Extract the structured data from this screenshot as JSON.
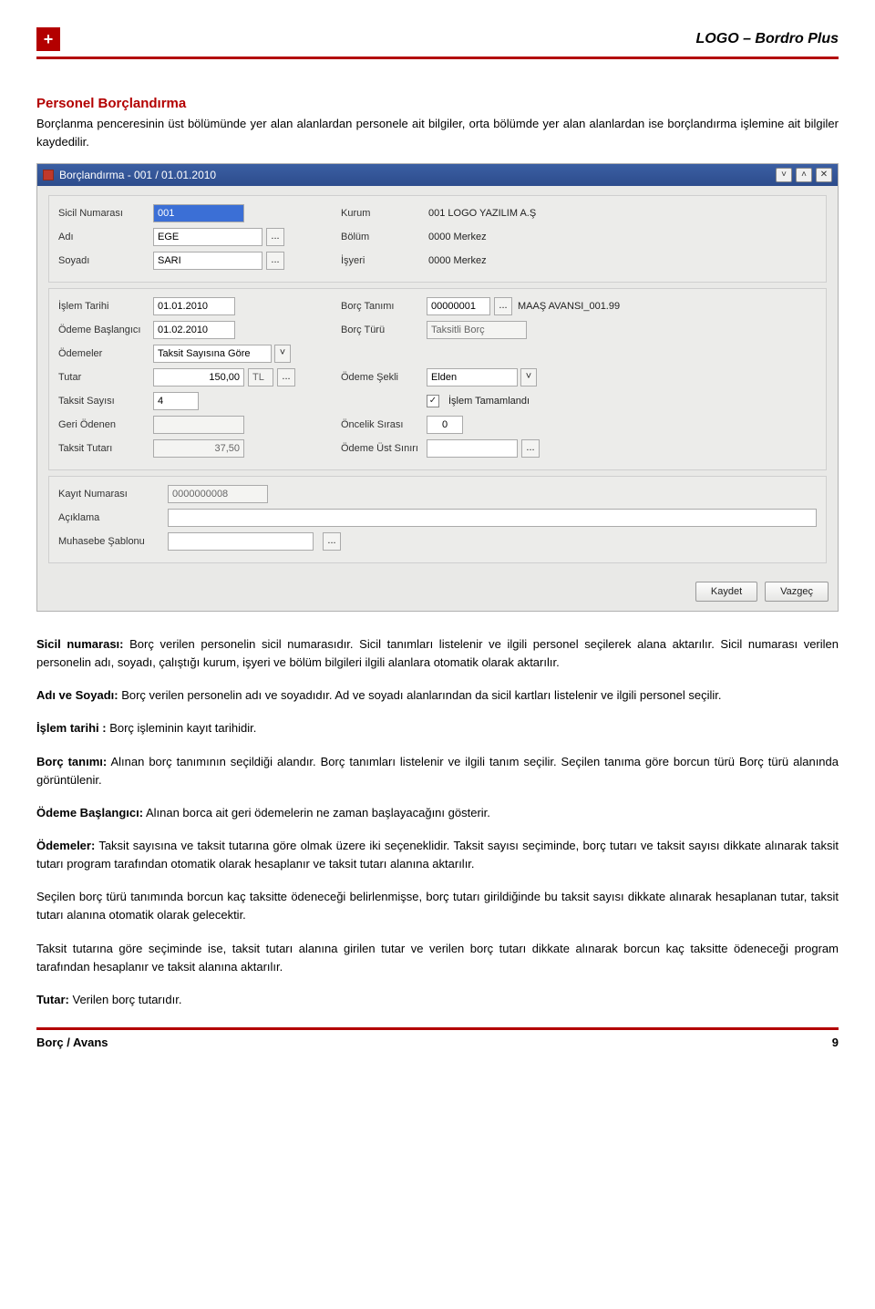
{
  "header": {
    "plus": "+",
    "brand": "LOGO – Bordro Plus"
  },
  "section_title": "Personel Borçlandırma",
  "intro": "Borçlanma penceresinin üst bölümünde yer alan alanlardan personele ait bilgiler, orta bölümde yer alan alanlardan ise borçlandırma işlemine ait bilgiler kaydedilir.",
  "window": {
    "title": "Borçlandırma - 001 / 01.01.2010",
    "tb_down": "˅",
    "tb_up": "˄",
    "tb_close": "✕",
    "top": {
      "sicil_lbl": "Sicil Numarası",
      "sicil_val": "001",
      "adi_lbl": "Adı",
      "adi_val": "EGE",
      "soyadi_lbl": "Soyadı",
      "soyadi_val": "SARI",
      "kurum_lbl": "Kurum",
      "kurum_val": "001 LOGO YAZILIM A.Ş",
      "bolum_lbl": "Bölüm",
      "bolum_val": "0000 Merkez",
      "isyeri_lbl": "İşyeri",
      "isyeri_val": "0000 Merkez"
    },
    "mid": {
      "islem_tarihi_lbl": "İşlem Tarihi",
      "islem_tarihi_val": "01.01.2010",
      "odeme_baslangici_lbl": "Ödeme Başlangıcı",
      "odeme_baslangici_val": "01.02.2010",
      "odemeler_lbl": "Ödemeler",
      "odemeler_val": "Taksit Sayısına Göre",
      "tutar_lbl": "Tutar",
      "tutar_val": "150,00",
      "tutar_cur": "TL",
      "taksit_sayisi_lbl": "Taksit Sayısı",
      "taksit_sayisi_val": "4",
      "geri_odenen_lbl": "Geri Ödenen",
      "geri_odenen_val": "",
      "taksit_tutari_lbl": "Taksit Tutarı",
      "taksit_tutari_val": "37,50",
      "borc_tanimi_lbl": "Borç Tanımı",
      "borc_tanimi_val": "00000001",
      "borc_tanimi_desc": "MAAŞ AVANSI_001.99",
      "borc_turu_lbl": "Borç Türü",
      "borc_turu_val": "Taksitli Borç",
      "odeme_sekli_lbl": "Ödeme Şekli",
      "odeme_sekli_val": "Elden",
      "islem_tamamlandi_lbl": "İşlem Tamamlandı",
      "islem_tamamlandi_check": "✓",
      "oncelik_sirasi_lbl": "Öncelik Sırası",
      "oncelik_sirasi_val": "0",
      "odeme_ust_siniri_lbl": "Ödeme Üst Sınırı",
      "odeme_ust_siniri_val": ""
    },
    "bot": {
      "kayit_no_lbl": "Kayıt Numarası",
      "kayit_no_val": "0000000008",
      "aciklama_lbl": "Açıklama",
      "aciklama_val": "",
      "muhasebe_lbl": "Muhasebe Şablonu",
      "muhasebe_val": ""
    },
    "btn_save": "Kaydet",
    "btn_cancel": "Vazgeç",
    "ellipsis": "..."
  },
  "defs": {
    "sicil_t": "Sicil numarası:",
    "sicil_b": " Borç verilen personelin sicil numarasıdır. Sicil tanımları listelenir ve ilgili personel seçilerek alana aktarılır. Sicil numarası verilen personelin adı, soyadı, çalıştığı kurum, işyeri ve bölüm bilgileri ilgili alanlara otomatik olarak aktarılır.",
    "adi_t": "Adı ve Soyadı:",
    "adi_b": " Borç verilen personelin adı ve soyadıdır. Ad ve soyadı alanlarından da sicil kartları listelenir ve ilgili personel seçilir.",
    "islem_t": "İşlem tarihi :",
    "islem_b": " Borç işleminin kayıt tarihidir.",
    "borc_t": "Borç tanımı:",
    "borc_b": " Alınan borç tanımının seçildiği alandır. Borç tanımları listelenir ve ilgili tanım seçilir. Seçilen tanıma göre borcun türü Borç türü alanında görüntülenir.",
    "odbas_t": "Ödeme Başlangıcı:",
    "odbas_b": " Alınan borca ait geri ödemelerin ne zaman başlayacağını gösterir.",
    "odeme_t": "Ödemeler:",
    "odeme_b": " Taksit sayısına ve taksit tutarına göre olmak üzere iki seçeneklidir. Taksit sayısı seçiminde, borç tutarı ve taksit sayısı dikkate alınarak taksit tutarı program tarafından otomatik olarak hesaplanır ve taksit tutarı alanına aktarılır.",
    "para2": "Seçilen borç türü tanımında borcun kaç taksitte ödeneceği belirlenmişse, borç tutarı girildiğinde bu taksit sayısı dikkate alınarak hesaplanan tutar, taksit tutarı alanına otomatik olarak gelecektir.",
    "para3": "Taksit tutarına göre seçiminde ise, taksit tutarı alanına girilen tutar ve verilen borç tutarı dikkate alınarak borcun kaç taksitte ödeneceği program tarafından hesaplanır ve taksit alanına aktarılır.",
    "tutar_t": "Tutar:",
    "tutar_b": " Verilen borç tutarıdır."
  },
  "footer": {
    "left": "Borç / Avans",
    "page": "9"
  }
}
